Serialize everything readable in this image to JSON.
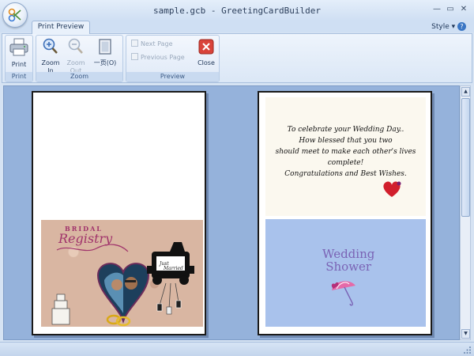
{
  "window": {
    "title": "sample.gcb - GreetingCardBuilder",
    "minimize_glyph": "—",
    "restore_glyph": "▭",
    "close_glyph": "✕"
  },
  "ribbon": {
    "active_tab": "Print Preview",
    "style_menu": "Style",
    "groups": {
      "print": {
        "label": "Print",
        "print_button": "Print"
      },
      "zoom": {
        "label": "Zoom",
        "zoom_in": [
          "Zoom",
          "In"
        ],
        "zoom_out": [
          "Zoom",
          "Out"
        ],
        "one_page": "一页(O)"
      },
      "preview": {
        "label": "Preview",
        "next_page": "Next Page",
        "previous_page": "Previous Page",
        "close": "Close"
      }
    }
  },
  "pages": {
    "left": {
      "bridal_text": "BRIDAL",
      "registry_text": "Registry"
    },
    "right": {
      "verse_lines": [
        "To celebrate your Wedding Day..",
        "How blessed that you two",
        "should meet to make each other's lives complete!",
        "Congratulations and Best Wishes."
      ],
      "shower_line1": "Wedding",
      "shower_line2": "Shower"
    }
  },
  "colors": {
    "accent": "#1e3658",
    "workspace": "#95b2db",
    "heart": "#d11f2c",
    "title_pink": "#a0336b"
  },
  "icons": {
    "app": "card-builder-icon",
    "print": "printer-icon",
    "zoom_in": "magnifier-plus-icon",
    "zoom_out": "magnifier-minus-icon",
    "one_page": "page-icon",
    "next": "next-page-icon",
    "prev": "previous-page-icon",
    "close": "close-x-icon"
  }
}
